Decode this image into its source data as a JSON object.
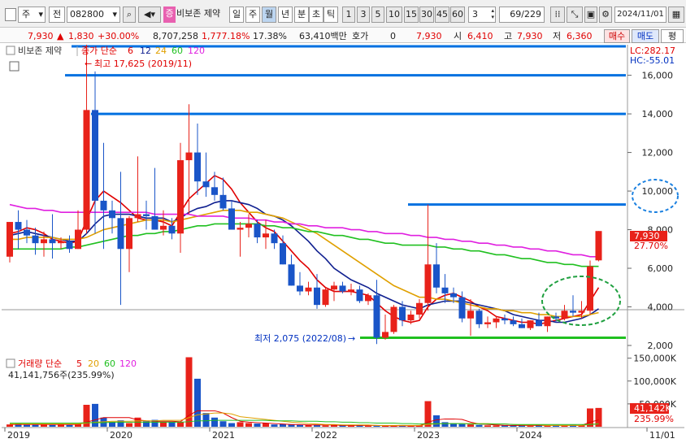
{
  "toolbar": {
    "type_label": "주",
    "prev_label": "전",
    "code": "082800",
    "stock_tag": "증",
    "stock_name": "비보존 제약",
    "periods": [
      "일",
      "주",
      "월",
      "년"
    ],
    "periods_selected": "월",
    "minute_labels": [
      "분",
      "초",
      "틱"
    ],
    "intervals": [
      "1",
      "3",
      "5",
      "10",
      "15",
      "30",
      "45",
      "60"
    ],
    "interval_value": "3",
    "count": "69",
    "total": "/229",
    "date": "2024/11/01"
  },
  "quote": {
    "price": "7,930",
    "change": "1,830",
    "change_pct": "+30.00%",
    "volume": "8,707,258",
    "volume_pct": "1,777.18%",
    "turnover_pct": "17.38%",
    "amount": "63,410백만",
    "ask_label": "호가",
    "ask_value": "0",
    "bid_price": "7,930",
    "open_label": "시",
    "open": "6,410",
    "high_label": "고",
    "high": "7,930",
    "low_label": "저",
    "low": "6,360",
    "buy_label": "매수",
    "sell_label": "매도",
    "eval_label": "평"
  },
  "price_panel": {
    "name_label": "비보존 제약",
    "legend_prefix": "종가 단순",
    "ma_periods": [
      "6",
      "12",
      "24",
      "60",
      "120"
    ],
    "ma_colors": [
      "#e00000",
      "#102090",
      "#e0a000",
      "#20c020",
      "#e020e0"
    ],
    "lc_label": "LC:282.17",
    "hc_label": "HC:-55.01",
    "high_annotation": "최고 17,625 (2019/11)",
    "low_annotation": "최저 2,075 (2022/08)",
    "last_price_label": "7,930",
    "last_pct_label": "27.70%",
    "y_ticks": [
      "16,000",
      "14,000",
      "12,000",
      "10,000",
      "8,000",
      "6,000",
      "4,000",
      "2,000"
    ]
  },
  "volume_panel": {
    "label": "거래량 단순",
    "ma_periods": [
      "5",
      "20",
      "60",
      "120"
    ],
    "value_label": "41,141,756주(235.99%)",
    "last_label": "41,142K",
    "last_pct": "235.99%",
    "y_ticks": [
      "150,000K",
      "100,000K",
      "50,000K"
    ]
  },
  "x_axis": [
    "2019",
    "2020",
    "2021",
    "2022",
    "2023",
    "2024",
    "11/01"
  ],
  "colors": {
    "up": "#e8221a",
    "down": "#1a55c8",
    "hline": "#0070e0",
    "support": "#20c020"
  },
  "chart_data": {
    "type": "candlestick",
    "title": "",
    "ylabel": "",
    "ylim": [
      2000,
      17500
    ],
    "y_ticks": [
      2000,
      4000,
      6000,
      8000,
      10000,
      12000,
      14000,
      16000
    ],
    "candles": [
      {
        "o": 6600,
        "h": 7800,
        "l": 6300,
        "c": 8400
      },
      {
        "o": 8400,
        "h": 9000,
        "l": 7000,
        "c": 8000
      },
      {
        "o": 8000,
        "h": 8500,
        "l": 7300,
        "c": 7700
      },
      {
        "o": 7700,
        "h": 8100,
        "l": 6700,
        "c": 7300
      },
      {
        "o": 7300,
        "h": 7900,
        "l": 6600,
        "c": 7500
      },
      {
        "o": 7500,
        "h": 8800,
        "l": 6500,
        "c": 7300
      },
      {
        "o": 7300,
        "h": 7600,
        "l": 7000,
        "c": 7400
      },
      {
        "o": 7400,
        "h": 7700,
        "l": 6800,
        "c": 7000
      },
      {
        "o": 7000,
        "h": 9000,
        "l": 7000,
        "c": 8000
      },
      {
        "o": 8000,
        "h": 17625,
        "l": 7800,
        "c": 14200
      },
      {
        "o": 14200,
        "h": 16200,
        "l": 7800,
        "c": 9500
      },
      {
        "o": 9500,
        "h": 12500,
        "l": 7000,
        "c": 9000
      },
      {
        "o": 9000,
        "h": 9500,
        "l": 7800,
        "c": 8600
      },
      {
        "o": 8600,
        "h": 11000,
        "l": 4100,
        "c": 7000
      },
      {
        "o": 7000,
        "h": 8700,
        "l": 5800,
        "c": 8600
      },
      {
        "o": 8600,
        "h": 11800,
        "l": 8400,
        "c": 8800
      },
      {
        "o": 8800,
        "h": 9500,
        "l": 8000,
        "c": 8700
      },
      {
        "o": 8700,
        "h": 11200,
        "l": 8300,
        "c": 8000
      },
      {
        "o": 8000,
        "h": 9000,
        "l": 7700,
        "c": 8200
      },
      {
        "o": 8200,
        "h": 8600,
        "l": 7500,
        "c": 7800
      },
      {
        "o": 7800,
        "h": 12500,
        "l": 6800,
        "c": 11600
      },
      {
        "o": 11600,
        "h": 14500,
        "l": 8800,
        "c": 12000
      },
      {
        "o": 12000,
        "h": 13500,
        "l": 9800,
        "c": 10500
      },
      {
        "o": 10500,
        "h": 12000,
        "l": 9700,
        "c": 10200
      },
      {
        "o": 10200,
        "h": 11000,
        "l": 9500,
        "c": 9800
      },
      {
        "o": 9800,
        "h": 10700,
        "l": 9000,
        "c": 9100
      },
      {
        "o": 9100,
        "h": 9500,
        "l": 8300,
        "c": 8000
      },
      {
        "o": 8000,
        "h": 8400,
        "l": 6600,
        "c": 8100
      },
      {
        "o": 8100,
        "h": 8800,
        "l": 7600,
        "c": 8300
      },
      {
        "o": 8300,
        "h": 8500,
        "l": 7300,
        "c": 7600
      },
      {
        "o": 7600,
        "h": 8500,
        "l": 7000,
        "c": 7800
      },
      {
        "o": 7800,
        "h": 8000,
        "l": 7000,
        "c": 7300
      },
      {
        "o": 7300,
        "h": 7700,
        "l": 6400,
        "c": 6200
      },
      {
        "o": 6200,
        "h": 6700,
        "l": 5300,
        "c": 5100
      },
      {
        "o": 5100,
        "h": 5800,
        "l": 4600,
        "c": 4800
      },
      {
        "o": 4800,
        "h": 5300,
        "l": 4600,
        "c": 5000
      },
      {
        "o": 5000,
        "h": 5700,
        "l": 3900,
        "c": 4100
      },
      {
        "o": 4100,
        "h": 5000,
        "l": 4000,
        "c": 4900
      },
      {
        "o": 4900,
        "h": 5300,
        "l": 4300,
        "c": 5100
      },
      {
        "o": 5100,
        "h": 5300,
        "l": 4700,
        "c": 4800
      },
      {
        "o": 4800,
        "h": 5200,
        "l": 4600,
        "c": 4900
      },
      {
        "o": 4900,
        "h": 5100,
        "l": 4200,
        "c": 4300
      },
      {
        "o": 4300,
        "h": 4700,
        "l": 4100,
        "c": 4600
      },
      {
        "o": 4600,
        "h": 5400,
        "l": 2075,
        "c": 2400
      },
      {
        "o": 2400,
        "h": 3600,
        "l": 2300,
        "c": 2700
      },
      {
        "o": 2700,
        "h": 4100,
        "l": 2600,
        "c": 4000
      },
      {
        "o": 4000,
        "h": 4300,
        "l": 3000,
        "c": 3300
      },
      {
        "o": 3300,
        "h": 3800,
        "l": 3100,
        "c": 3600
      },
      {
        "o": 3600,
        "h": 4400,
        "l": 3400,
        "c": 4200
      },
      {
        "o": 4200,
        "h": 9300,
        "l": 3800,
        "c": 6200
      },
      {
        "o": 6200,
        "h": 7300,
        "l": 4700,
        "c": 5000
      },
      {
        "o": 5000,
        "h": 5700,
        "l": 4200,
        "c": 4700
      },
      {
        "o": 4700,
        "h": 5000,
        "l": 4200,
        "c": 4500
      },
      {
        "o": 4500,
        "h": 4800,
        "l": 3200,
        "c": 3400
      },
      {
        "o": 3400,
        "h": 4400,
        "l": 2500,
        "c": 3800
      },
      {
        "o": 3800,
        "h": 3900,
        "l": 2900,
        "c": 3100
      },
      {
        "o": 3100,
        "h": 3500,
        "l": 2900,
        "c": 3200
      },
      {
        "o": 3200,
        "h": 3500,
        "l": 2900,
        "c": 3400
      },
      {
        "o": 3400,
        "h": 3600,
        "l": 3100,
        "c": 3300
      },
      {
        "o": 3300,
        "h": 3500,
        "l": 3000,
        "c": 3100
      },
      {
        "o": 3100,
        "h": 3400,
        "l": 2900,
        "c": 2900
      },
      {
        "o": 2900,
        "h": 3300,
        "l": 2800,
        "c": 3300
      },
      {
        "o": 3300,
        "h": 3700,
        "l": 3000,
        "c": 3000
      },
      {
        "o": 3000,
        "h": 3500,
        "l": 2700,
        "c": 3500
      },
      {
        "o": 3500,
        "h": 3700,
        "l": 3200,
        "c": 3400
      },
      {
        "o": 3400,
        "h": 4100,
        "l": 3300,
        "c": 3800
      },
      {
        "o": 3800,
        "h": 4600,
        "l": 3500,
        "c": 3700
      },
      {
        "o": 3700,
        "h": 4300,
        "l": 3400,
        "c": 3800
      },
      {
        "o": 3800,
        "h": 6400,
        "l": 3600,
        "c": 6100
      },
      {
        "o": 6410,
        "h": 7930,
        "l": 6360,
        "c": 7930
      }
    ],
    "ma": {
      "6": [
        7800,
        7900,
        8100,
        8000,
        7800,
        7500,
        7400,
        7300,
        7400,
        8500,
        9500,
        10000,
        9700,
        9400,
        9000,
        8600,
        8500,
        8500,
        8400,
        8200,
        8900,
        9600,
        10000,
        10400,
        10800,
        10600,
        10100,
        9400,
        8900,
        8400,
        8100,
        7900,
        7400,
        6900,
        6400,
        6000,
        5400,
        5000,
        4800,
        4800,
        4800,
        4700,
        4600,
        4200,
        3800,
        3500,
        3300,
        3200,
        3300,
        4000,
        4400,
        4600,
        4700,
        4500,
        4300,
        4000,
        3800,
        3500,
        3400,
        3300,
        3200,
        3200,
        3100,
        3200,
        3300,
        3400,
        3500,
        3600,
        4300,
        5000
      ],
      "12": [
        7700,
        7800,
        7900,
        7800,
        7700,
        7600,
        7500,
        7400,
        7400,
        7800,
        8300,
        8700,
        8800,
        8800,
        8800,
        8700,
        8600,
        8600,
        8600,
        8400,
        8600,
        8900,
        9100,
        9200,
        9400,
        9500,
        9500,
        9400,
        9300,
        9100,
        8800,
        8700,
        8500,
        8200,
        7800,
        7400,
        6900,
        6500,
        6000,
        5700,
        5400,
        5200,
        5000,
        4700,
        4500,
        4300,
        4100,
        4000,
        3900,
        4100,
        4200,
        4300,
        4300,
        4300,
        4200,
        4100,
        4000,
        3900,
        3800,
        3600,
        3500,
        3400,
        3300,
        3300,
        3200,
        3200,
        3300,
        3400,
        3600,
        3900
      ],
      "24": [
        7500,
        7500,
        7600,
        7600,
        7600,
        7600,
        7500,
        7500,
        7500,
        7600,
        7800,
        8000,
        8100,
        8200,
        8300,
        8400,
        8500,
        8500,
        8500,
        8400,
        8500,
        8600,
        8700,
        8800,
        8900,
        9000,
        9000,
        9000,
        8900,
        8900,
        8800,
        8700,
        8600,
        8400,
        8200,
        8000,
        7800,
        7500,
        7200,
        6900,
        6600,
        6300,
        6000,
        5700,
        5400,
        5100,
        4900,
        4700,
        4500,
        4500,
        4400,
        4400,
        4300,
        4200,
        4100,
        4000,
        3900,
        3900,
        3800,
        3800,
        3700,
        3700,
        3600,
        3600,
        3500,
        3500,
        3500,
        3500,
        3600,
        3700
      ],
      "60": [
        7000,
        7000,
        7000,
        7000,
        7000,
        7000,
        7000,
        7100,
        7100,
        7200,
        7300,
        7400,
        7500,
        7600,
        7700,
        7700,
        7800,
        7800,
        7900,
        7900,
        8000,
        8100,
        8200,
        8200,
        8300,
        8300,
        8300,
        8300,
        8300,
        8300,
        8200,
        8200,
        8100,
        8100,
        8000,
        7900,
        7900,
        7800,
        7700,
        7700,
        7600,
        7500,
        7500,
        7400,
        7300,
        7300,
        7200,
        7200,
        7200,
        7200,
        7100,
        7100,
        7000,
        7000,
        6900,
        6900,
        6800,
        6700,
        6700,
        6600,
        6500,
        6500,
        6400,
        6300,
        6300,
        6200,
        6200,
        6100,
        6100,
        6100
      ],
      "120": [
        9300,
        9200,
        9100,
        9100,
        9000,
        9000,
        8900,
        8900,
        8900,
        8900,
        8900,
        8900,
        8900,
        8900,
        8900,
        8900,
        8900,
        8800,
        8800,
        8800,
        8800,
        8800,
        8700,
        8700,
        8700,
        8700,
        8600,
        8600,
        8600,
        8500,
        8500,
        8400,
        8400,
        8300,
        8300,
        8200,
        8200,
        8100,
        8100,
        8100,
        8000,
        8000,
        7900,
        7900,
        7800,
        7800,
        7800,
        7700,
        7700,
        7600,
        7600,
        7500,
        7500,
        7400,
        7400,
        7300,
        7300,
        7200,
        7200,
        7100,
        7100,
        7000,
        7000,
        6900,
        6900,
        6800,
        6700,
        6700,
        6600,
        6600
      ]
    },
    "volume_ylim": [
      0,
      160000
    ],
    "volume_k": [
      5000,
      7000,
      6000,
      5000,
      5000,
      4000,
      5000,
      4000,
      6000,
      48000,
      50000,
      20000,
      10000,
      14000,
      8000,
      20000,
      12000,
      15000,
      10000,
      10000,
      10000,
      152000,
      105000,
      30000,
      20000,
      12000,
      8000,
      10000,
      8000,
      7000,
      8000,
      5000,
      6000,
      5000,
      4000,
      4000,
      4000,
      3000,
      4000,
      3000,
      3000,
      3000,
      2000,
      2000,
      2000,
      3000,
      3000,
      2000,
      3000,
      56000,
      25000,
      10000,
      8000,
      6000,
      5000,
      4000,
      3000,
      3000,
      3000,
      3000,
      3000,
      2000,
      3000,
      2000,
      3000,
      3000,
      4000,
      3000,
      40000,
      41142
    ],
    "volume_ma": [
      {
        "name": "5",
        "values": [
          5000,
          5000,
          5000,
          5000,
          5000,
          5000,
          5000,
          5000,
          5000,
          10000,
          15000,
          20000,
          20000,
          20000,
          20000,
          15000,
          13000,
          12000,
          12000,
          12000,
          11000,
          25000,
          35000,
          35000,
          35000,
          30000,
          20000,
          12000,
          10000,
          9000,
          8000,
          7000,
          6000,
          5000,
          5000,
          4000,
          4000,
          4000,
          4000,
          3000,
          3000,
          3000,
          3000,
          3000,
          2000,
          2000,
          2000,
          2000,
          2000,
          10000,
          15000,
          17000,
          17000,
          16000,
          10000,
          6000,
          5000,
          4000,
          3000,
          3000,
          3000,
          3000,
          3000,
          3000,
          3000,
          3000,
          3000,
          3000,
          10000,
          15000
        ]
      },
      {
        "name": "20",
        "values": [
          6000,
          6000,
          6000,
          6000,
          6000,
          6000,
          6000,
          6000,
          6000,
          8000,
          10000,
          11000,
          12000,
          12000,
          12000,
          13000,
          13000,
          13000,
          14000,
          14000,
          14000,
          20000,
          26000,
          28000,
          30000,
          30000,
          28000,
          22000,
          20000,
          18000,
          16000,
          14000,
          12000,
          10000,
          9000,
          7000,
          6000,
          5000,
          5000,
          4000,
          4000,
          4000,
          4000,
          3000,
          3000,
          3000,
          3000,
          3000,
          3000,
          5000,
          6000,
          7000,
          7000,
          7000,
          7000,
          7000,
          7000,
          6000,
          6000,
          5000,
          4000,
          4000,
          4000,
          3000,
          3000,
          3000,
          3000,
          3000,
          5000,
          7000
        ]
      },
      {
        "name": "60",
        "values": [
          8000,
          8000,
          8000,
          8000,
          8000,
          8000,
          8000,
          8000,
          8000,
          9000,
          9000,
          9000,
          10000,
          10000,
          10000,
          10000,
          10000,
          10000,
          10000,
          10000,
          10000,
          11000,
          13000,
          13000,
          14000,
          14000,
          14000,
          14000,
          14000,
          14000,
          14000,
          13000,
          13000,
          13000,
          12000,
          12000,
          12000,
          11000,
          11000,
          10000,
          10000,
          9000,
          9000,
          8000,
          8000,
          8000,
          7000,
          7000,
          6000,
          7000,
          7000,
          7000,
          7000,
          7000,
          6000,
          6000,
          6000,
          6000,
          6000,
          5000,
          5000,
          5000,
          5000,
          5000,
          5000,
          5000,
          5000,
          5000,
          5000,
          6000
        ]
      }
    ],
    "x_labels": [
      "2019",
      "2020",
      "2021",
      "2022",
      "2023",
      "2024",
      "11/01"
    ],
    "x_label_index": [
      0,
      12,
      24,
      36,
      48,
      60,
      69.9
    ],
    "resistance_levels": [
      17500,
      16000,
      14000
    ],
    "resistance_level_late": 9300,
    "support_level": 2400
  }
}
